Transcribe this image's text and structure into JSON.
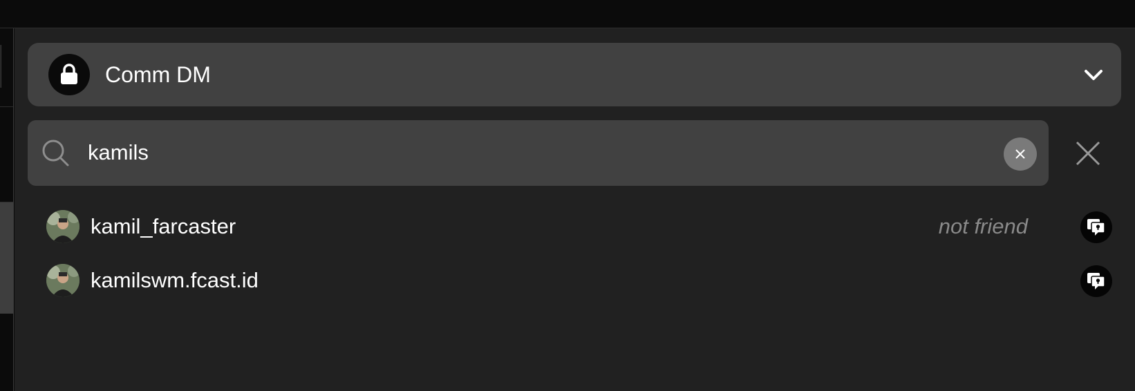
{
  "thread": {
    "title": "Comm DM",
    "icons": {
      "lock": "lock-icon",
      "expand": "chevron-down-icon"
    }
  },
  "search": {
    "value": "kamils",
    "placeholder": "",
    "icons": {
      "search": "search-icon",
      "clear": "clear-icon",
      "close": "close-icon"
    }
  },
  "results": [
    {
      "name": "kamil_farcaster",
      "status": "not friend",
      "action_icon": "dm-chat-icon"
    },
    {
      "name": "kamilswm.fcast.id",
      "status": "",
      "action_icon": "dm-chat-icon"
    }
  ],
  "colors": {
    "background": "#212121",
    "header_bg": "#414141",
    "search_bg": "#414141",
    "status_text": "#8a8a8a",
    "clear_button": "#7a7a7a"
  }
}
